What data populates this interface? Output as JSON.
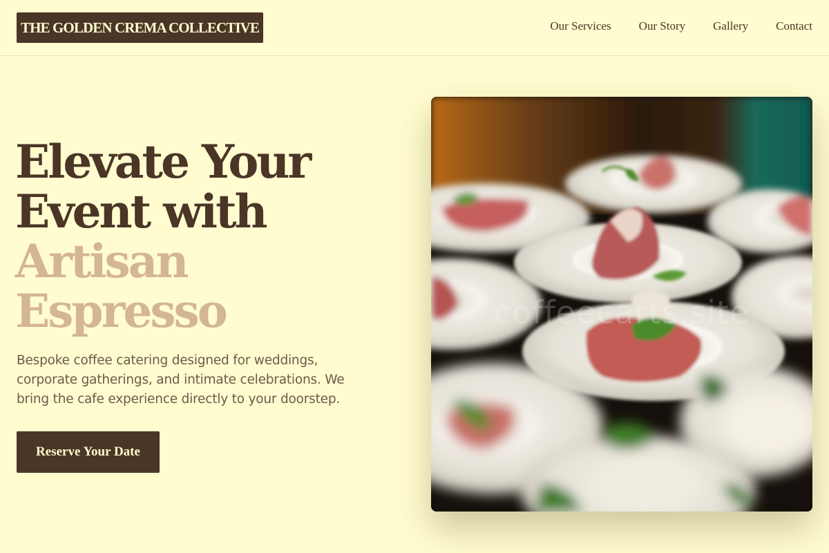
{
  "header": {
    "logo": "THE GOLDEN CREMA COLLECTIVE",
    "nav": [
      {
        "label": "Our Services"
      },
      {
        "label": "Our Story"
      },
      {
        "label": "Gallery"
      },
      {
        "label": "Contact"
      }
    ]
  },
  "hero": {
    "headline_lines": [
      "Elevate Your",
      "Event with",
      "Artisan",
      "Espresso"
    ],
    "lead": "Bespoke coffee catering designed for weddings, corporate gatherings, and intimate celebrations. We bring the cafe experience directly to your doorstep.",
    "cta_label": "Reserve Your Date",
    "image": {
      "watermark": "coffeecarts.site"
    }
  },
  "colors": {
    "background": "#fffccf",
    "primary": "#4a3526",
    "accent": "#d4b692"
  }
}
